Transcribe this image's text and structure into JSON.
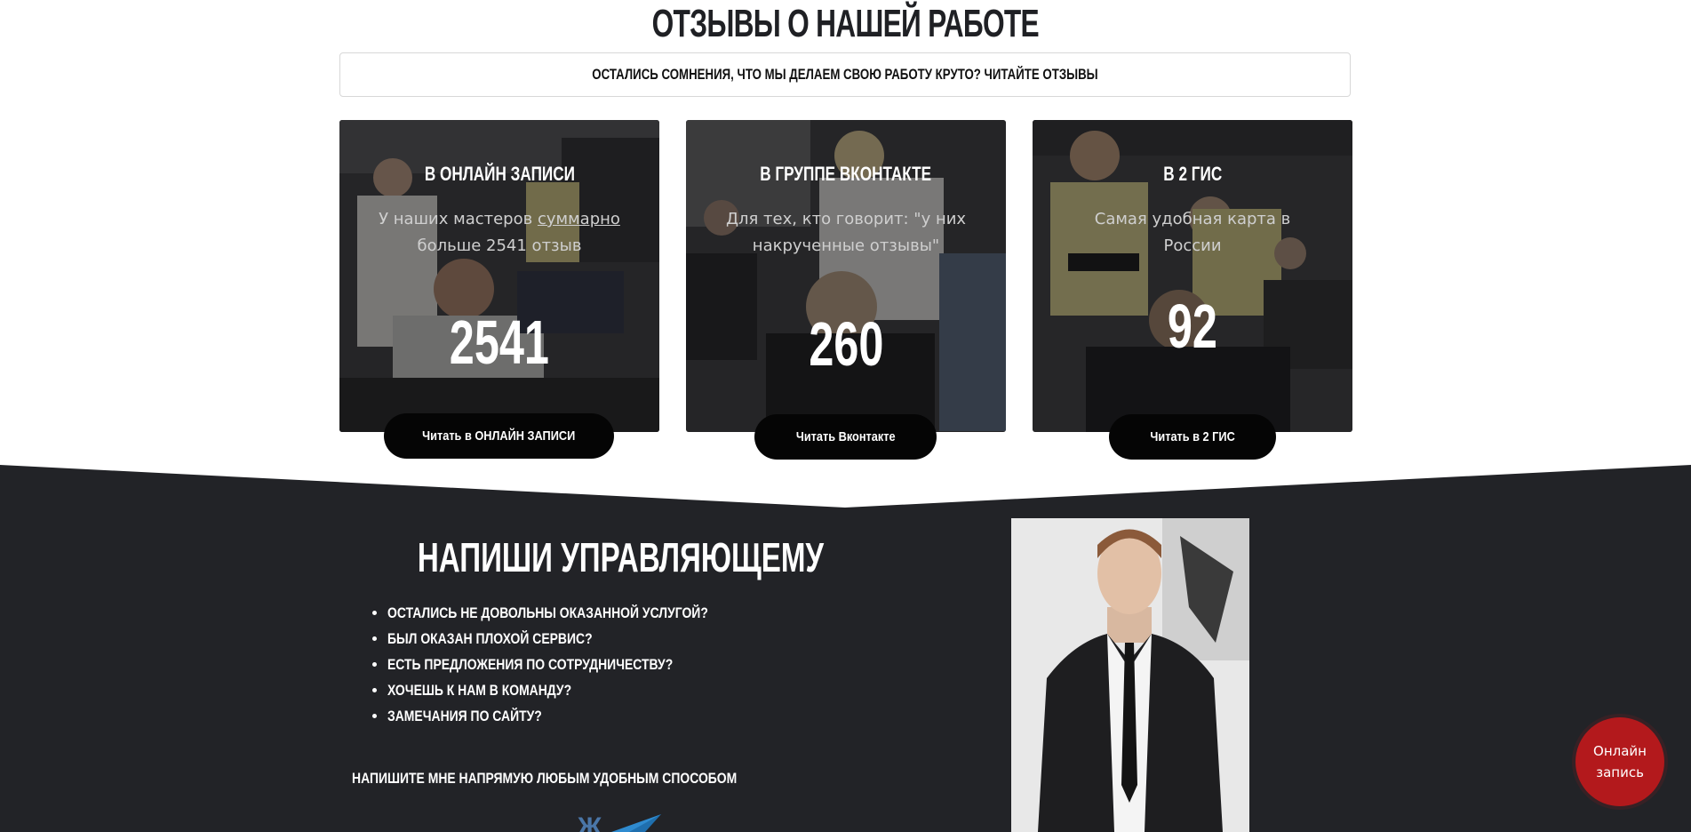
{
  "reviews": {
    "title": "ОТЗЫВЫ О НАШЕЙ РАБОТЕ",
    "subtitle": "ОСТАЛИСЬ СОМНЕНИЯ, ЧТО МЫ ДЕЛАЕМ СВОЮ РАБОТУ КРУТО? ЧИТАЙТЕ ОТЗЫВЫ",
    "cards": [
      {
        "title": "В ОНЛАЙН ЗАПИСИ",
        "desc_pre": "У наших мастеров ",
        "desc_underlined": "суммарно",
        "desc_post": " больше 2541 отзыв",
        "number": "2541",
        "button": "Читать в ОНЛАЙН ЗАПИСИ"
      },
      {
        "title": "В ГРУППЕ ВКОНТАКТЕ",
        "desc_pre": "Для тех, кто говорит: \"у них накрученные отзывы\"",
        "desc_underlined": "",
        "desc_post": "",
        "number": "260",
        "button": "Читать Вконтакте"
      },
      {
        "title": "В 2 ГИС",
        "desc_pre": "Самая удобная карта в России",
        "desc_underlined": "",
        "desc_post": "",
        "number": "92",
        "button": "Читать в 2 ГИС"
      }
    ]
  },
  "manager": {
    "title": "НАПИШИ УПРАВЛЯЮЩЕМУ",
    "items": [
      "ОСТАЛИСЬ НЕ ДОВОЛЬНЫ ОКАЗАННОЙ УСЛУГОЙ?",
      "БЫЛ ОКАЗАН ПЛОХОЙ СЕРВИС?",
      "ЕСТЬ ПРЕДЛОЖЕНИЯ ПО СОТРУДНИЧЕСТВУ?",
      "ХОЧЕШЬ К НАМ В КОМАНДУ?",
      "ЗАМЕЧАНИЯ ПО САЙТУ?"
    ],
    "contact_text": "НАПИШИТЕ МНЕ НАПРЯМУЮ ЛЮБЫМ УДОБНЫМ СПОСОБОМ",
    "contact_icons": [
      "vk-icon",
      "telegram-icon"
    ]
  },
  "floating": {
    "line1": "Онлайн",
    "line2": "запись"
  },
  "colors": {
    "dark": "#222327",
    "accent_red": "#b3191c",
    "button": "#050505"
  }
}
